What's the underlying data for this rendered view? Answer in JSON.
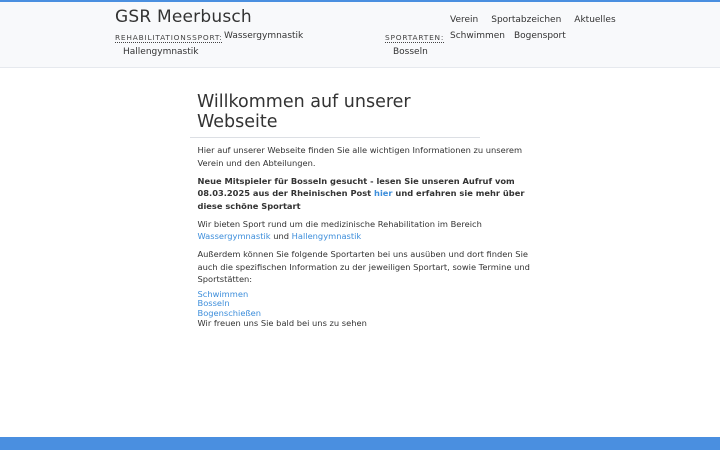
{
  "header": {
    "site_title": "GSR Meerbusch",
    "main_nav": [
      "Verein",
      "Sportabzeichen",
      "Aktuelles"
    ],
    "rehab_label": "REHABILITATIONSSPORT:",
    "rehab_items": [
      "Wassergymnastik",
      "Hallengymnastik"
    ],
    "sport_label": "SPORTARTEN:",
    "sport_items": [
      "Schwimmen",
      "Bogensport",
      "Bosseln"
    ]
  },
  "main": {
    "title": "Willkommen auf unserer Webseite",
    "intro": "Hier auf unserer Webseite finden Sie alle wichtigen Informationen zu unserem Verein und den Abteilungen.",
    "notice_before": "Neue Mitspieler für Bosseln gesucht - lesen Sie unseren Aufruf vom 08.03.2025 aus der Rheinischen Post ",
    "notice_link": "hier",
    "notice_after": " und erfahren sie mehr über diese schöne Sportart",
    "rehab_text": "Wir bieten Sport rund um die medizinische Rehabilitation im Bereich",
    "rehab_link_1": "Wassergymnastik",
    "rehab_connector": "und",
    "rehab_link_2": "Hallengymnastik",
    "sports_text": "Außerdem können Sie folgende Sportarten bei uns ausüben und dort finden Sie auch die spezifischen Information zu der jeweiligen Sportart, sowie Termine und Sportstätten:",
    "sport_links": [
      "Schwimmen",
      "Bosseln",
      "Bogenschießen"
    ],
    "closing": "Wir freuen uns Sie bald bei uns zu sehen"
  },
  "colors": {
    "accent": "#4a8fe0",
    "link": "#3d8edb",
    "header_bg": "#f8f9fb"
  }
}
